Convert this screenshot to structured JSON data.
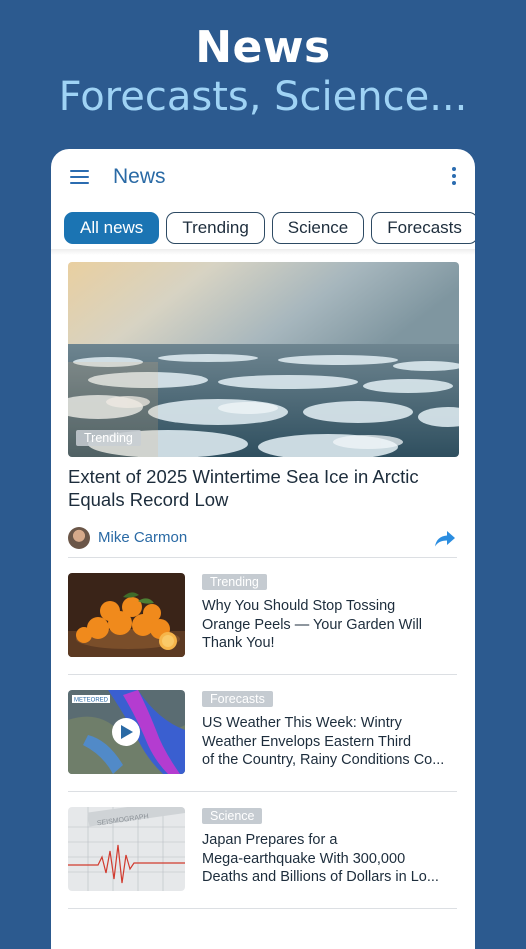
{
  "promo": {
    "title": "News",
    "subtitle": "Forecasts, Science..."
  },
  "appbar": {
    "title": "News",
    "menu_icon": "hamburger-menu-icon",
    "more_icon": "more-vertical-icon"
  },
  "filters": [
    {
      "label": "All news",
      "active": true
    },
    {
      "label": "Trending",
      "active": false
    },
    {
      "label": "Science",
      "active": false
    },
    {
      "label": "Forecasts",
      "active": false
    }
  ],
  "featured": {
    "tag": "Trending",
    "title": "Extent of 2025 Wintertime Sea Ice in Arctic Equals Record Low",
    "author": "Mike Carmon",
    "share_icon": "share-icon"
  },
  "articles": [
    {
      "tag": "Trending",
      "title_lines": [
        "Why You Should Stop Tossing",
        "Orange Peels — Your Garden Will",
        "Thank You!"
      ]
    },
    {
      "tag": "Forecasts",
      "title_lines": [
        "US Weather This Week: Wintry",
        "Weather Envelops Eastern Third",
        "of the Country, Rainy Conditions Co..."
      ],
      "thumb_label": "METEORED"
    },
    {
      "tag": "Science",
      "title_lines": [
        "Japan Prepares for a",
        "Mega-earthquake With 300,000",
        "Deaths and Billions of Dollars in Lo..."
      ],
      "thumb_label": "SEISMOGRAPH"
    }
  ],
  "colors": {
    "background": "#2c5a8f",
    "accent": "#1b74b3",
    "subtitle": "#9fd3f5"
  }
}
